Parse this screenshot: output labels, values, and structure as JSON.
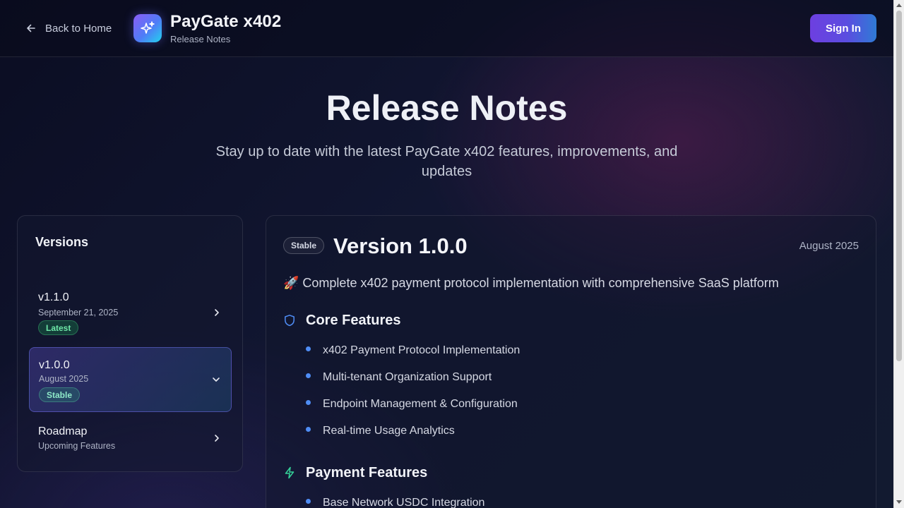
{
  "header": {
    "back_label": "Back to Home",
    "brand_name": "PayGate x402",
    "brand_subtitle": "Release Notes",
    "sign_in_label": "Sign In"
  },
  "hero": {
    "title": "Release Notes",
    "subtitle": "Stay up to date with the latest PayGate x402 features, improvements, and updates"
  },
  "sidebar": {
    "title": "Versions",
    "items": [
      {
        "name": "v1.1.0",
        "date": "September 21, 2025",
        "badge": "Latest",
        "expanded": false
      },
      {
        "name": "v1.0.0",
        "date": "August 2025",
        "badge": "Stable",
        "expanded": true
      },
      {
        "name": "Roadmap",
        "date": "Upcoming Features",
        "badge": "",
        "expanded": false
      }
    ]
  },
  "release": {
    "badge": "Stable",
    "title": "Version 1.0.0",
    "date": "August 2025",
    "summary": "🚀 Complete x402 payment protocol implementation with comprehensive SaaS platform",
    "sections": [
      {
        "title": "Core Features",
        "icon": "shield-icon",
        "items": [
          "x402 Payment Protocol Implementation",
          "Multi-tenant Organization Support",
          "Endpoint Management & Configuration",
          "Real-time Usage Analytics"
        ]
      },
      {
        "title": "Payment Features",
        "icon": "lightning-icon",
        "items": [
          "Base Network USDC Integration"
        ]
      }
    ]
  },
  "colors": {
    "accent_purple": "#6d3fe0",
    "accent_blue": "#4f8df5",
    "latest_green": "#6ee7a8",
    "stable_teal": "#8ee8c8"
  }
}
